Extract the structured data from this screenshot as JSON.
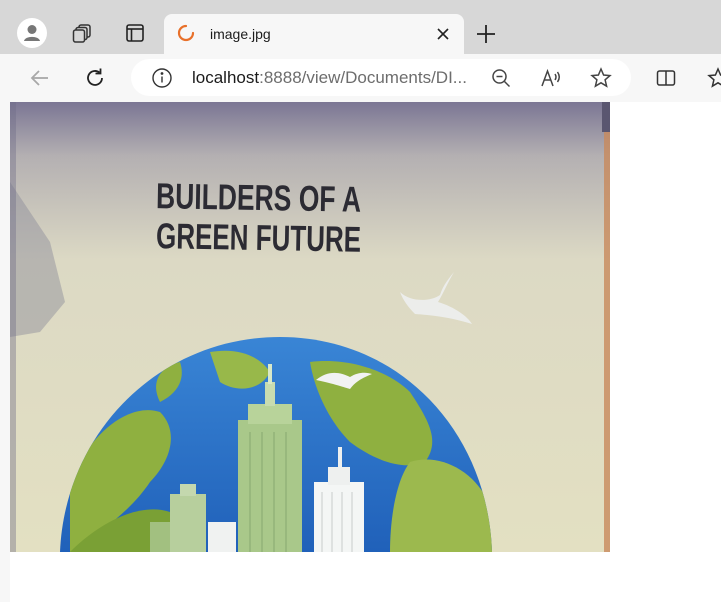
{
  "browser": {
    "profile_icon": "profile-icon",
    "workspaces_icon": "workspaces-icon",
    "tab_actions_icon": "vertical-tabs-icon",
    "tab": {
      "title": "image.jpg",
      "status_icon": "loading-spinner-icon",
      "close_icon": "close-icon"
    },
    "new_tab_icon": "plus-icon",
    "toolbar": {
      "back_icon": "back-arrow-icon",
      "refresh_icon": "refresh-icon",
      "site_info_icon": "info-icon",
      "url_host": "localhost",
      "url_rest": ":8888/view/Documents/DI...",
      "zoom_icon": "zoom-out-icon",
      "read_aloud_icon": "read-aloud-icon",
      "favorite_icon": "star-icon",
      "split_screen_icon": "split-screen-icon",
      "favorites_bar_icon": "favorites-icon"
    }
  },
  "content": {
    "image": {
      "headline_line1": "BUILDERS OF A",
      "headline_line2": "GREEN FUTURE"
    }
  },
  "colors": {
    "tabbar": "#d7d7d7",
    "toolbar": "#f7f7f7",
    "spinner": "#e8702a",
    "wall": "#ddd9be",
    "ocean": "#2f79d0",
    "land": "#8fb040"
  }
}
